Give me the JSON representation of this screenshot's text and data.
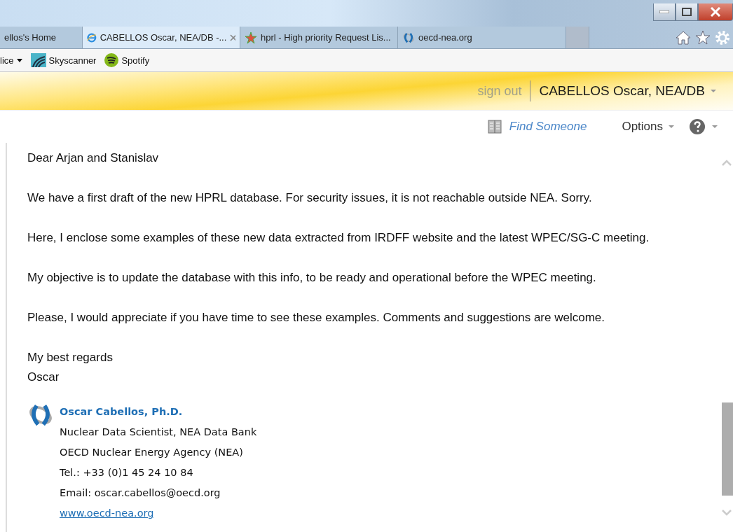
{
  "tabs": [
    {
      "label": "ellos's Home",
      "selected": false
    },
    {
      "label": "CABELLOS Oscar, NEA/DB -...",
      "selected": true
    },
    {
      "label": "hprl - High priority Request Lis...",
      "selected": false
    },
    {
      "label": "oecd-nea.org",
      "selected": false
    }
  ],
  "favorites": [
    {
      "label": "lice",
      "kind": "menu"
    },
    {
      "label": "Skyscanner",
      "kind": "skyscanner"
    },
    {
      "label": "Spotify",
      "kind": "spotify"
    }
  ],
  "header": {
    "sign_out": "sign out",
    "user": "CABELLOS Oscar, NEA/DB"
  },
  "nav": {
    "find_someone": "Find Someone",
    "options": "Options"
  },
  "message": {
    "paragraphs": [
      [
        "Dear Arjan and Stanislav"
      ],
      [
        "We have a first draft of the new HPRL database. For security issues, it is not reachable outside NEA. Sorry."
      ],
      [
        "Here, I enclose some examples of these new data extracted from IRDFF website and the latest WPEC/SG-C meeting."
      ],
      [
        "My objective is to update the database with this info, to be ready and operational before the WPEC meeting."
      ],
      [
        "Please, I would appreciate if you have time to see these examples. Comments and suggestions are welcome."
      ],
      [
        "My best regards",
        "Oscar"
      ]
    ],
    "signature": {
      "name": "Oscar Cabellos, Ph.D.",
      "lines": [
        "Nuclear Data Scientist, NEA Data Bank",
        "OECD Nuclear Energy Agency (NEA)",
        "Tel.: +33 (0)1 45 24 10 84",
        "Email: oscar.cabellos@oecd.org"
      ],
      "link": "www.oecd-nea.org"
    }
  }
}
